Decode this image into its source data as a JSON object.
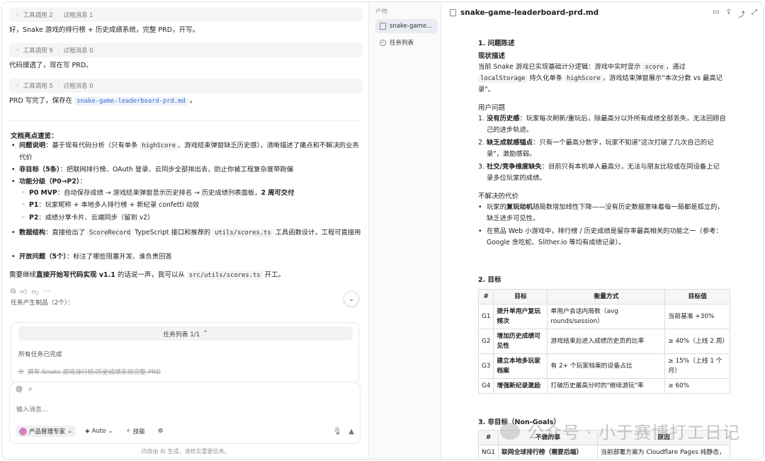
{
  "chat": {
    "tool_rows": [
      {
        "label": "工具调用 2",
        "sep": "·",
        "sub": "过程消息 1"
      },
      {
        "label": "工具调用 9",
        "sep": "·",
        "sub": "过程消息 0"
      },
      {
        "label": "工具调用 5",
        "sep": "·",
        "sub": "过程消息 0"
      }
    ],
    "msg1": "好，Snake 游戏的排行榜 + 历史成绩系统，完整 PRD，开写。",
    "msg2": "代码摸透了，现在写 PRD。",
    "msg3_pre": "PRD 写完了，保存在",
    "msg3_file": "snake-game-leaderboard-prd.md",
    "msg3_post": "。",
    "highlights_title": "文档亮点速览：",
    "bullets": {
      "b1_bold": "问题说明",
      "b1_a": "：基于现有代码分析（只有单条 ",
      "b1_code": "highScore",
      "b1_b": "、游戏结束弹窗缺乏历史感），清晰描述了痛点和不解决的业务代价",
      "b2_bold": "非目标（5条）",
      "b2_text": "：把联网排行榜、OAuth 登录、云同步全部排出去，防止你被工程复杂度带跑偏",
      "b3_bold": "功能分级（P0→P2）",
      "b3_text": "：",
      "s1_bold": "P0 MVP",
      "s1_text": "：自动保存成绩 → 游戏结束弹窗显示历史排名 → 历史成绩列表面板，",
      "s1_bold2": "2 周可交付",
      "s2_bold": "P1",
      "s2_text": "：玩家昵称 + 本地多人排行榜 + 新纪录 confetti 动效",
      "s3_bold": "P2",
      "s3_text": "：成绩分享卡片、云端同步（留到 v2）",
      "b4_bold": "数据结构",
      "b4_a": "：直接给出了 ",
      "b4_code1": "ScoreRecord",
      "b4_b": " TypeScript 接口和推荐的 ",
      "b4_code2": "utils/scores.ts",
      "b4_c": " 工具函数设计，工程可直接用",
      "b5_bold": "开放问题（5个）",
      "b5_text": "：标注了哪些阻塞开发、谁负责回答"
    },
    "closing_pre": "需要继续",
    "closing_bold": "直接开始写代码实现 v1.1",
    "closing_mid": " 的话说一声，我可以从 ",
    "closing_code": "src/utils/scores.ts",
    "closing_post": " 开工。",
    "artifacts_label": "任务产生制品（2个）：",
    "task_list": {
      "header": "任务列表 1/1",
      "status": "所有任务已完成",
      "item": "撰写 Snake 游戏排行榜/历史成绩系统完整 PRD"
    },
    "composer": {
      "placeholder": "输入消息...",
      "agent": "产品管理专家",
      "mode": "Auto",
      "skills": "技能"
    },
    "footnote": "内容由 AI 生成，请核实重要信息。"
  },
  "artifacts": {
    "label": "产物",
    "items": [
      "snake-game...",
      "任务列表"
    ]
  },
  "doc": {
    "title": "snake-game-leaderboard-prd.md",
    "s1_title": "1. 问题陈述",
    "s1_sub": "现状描述",
    "s1_p_a": "当前 Snake 游戏已实现基础计分逻辑：游戏中实时显示 ",
    "s1_p_code1": "score",
    "s1_p_b": "，通过 ",
    "s1_p_code2": "localStorage",
    "s1_p_c": " 持久化单条 ",
    "s1_p_code3": "highScore",
    "s1_p_d": "，游戏结束弹窗展示\"本次分数 vs 最高记录\"。",
    "user_problems": "用户问题",
    "problems": [
      {
        "n": "1.",
        "bold": "没有历史感",
        "text": "：玩家每次刷新/重玩后，除最高分以外所有成绩全部丢失，无法回顾自己的进步轨迹。"
      },
      {
        "n": "2.",
        "bold": "缺乏成就感锚点",
        "text": "：只有一个最高分数字，玩家不知道\"这次打破了几次自己的记录\"，激励感弱。"
      },
      {
        "n": "3.",
        "bold": "社交/竞争维度缺失",
        "text": "：目前只有本机单人最高分，无法与朋友比较或在同设备上记录多位玩家的成绩。"
      }
    ],
    "cost_title": "不解决的代价",
    "costs": [
      {
        "pre": "玩家的",
        "bold": "复玩动机",
        "text": "随局数增加线性下降——没有历史数据意味着每一局都是孤立的，缺乏进步可见性。"
      },
      {
        "pre": "",
        "bold": "",
        "text": "在竞品 Web 小游戏中，排行榜 / 历史成绩是留存率最高相关的功能之一（参考：Google 贪吃蛇、Slither.io 等均有成绩记录）。"
      }
    ],
    "s2_title": "2. 目标",
    "goals_headers": [
      "#",
      "目标",
      "衡量方式",
      "目标值"
    ],
    "goals": [
      {
        "id": "G1",
        "goal": "提升单用户复玩频次",
        "measure": "单用户会话内局数（avg rounds/session）",
        "target": "当前基准 +30%"
      },
      {
        "id": "G2",
        "goal": "增加历史成绩可见性",
        "measure": "游戏结束后进入成绩历史页的比率",
        "target": "≥ 40%（上线 2 周）"
      },
      {
        "id": "G3",
        "goal": "建立本地多玩家档案",
        "measure": "有 2+ 个玩家档案的设备占比",
        "target": "≥ 15%（上线 1 个月）"
      },
      {
        "id": "G4",
        "goal": "增强新纪录激励",
        "measure": "打破历史最高分时的\"继续游玩\"率",
        "target": "≥ 60%"
      }
    ],
    "s3_title": "3. 非目标（Non-Goals）",
    "ng_headers": [
      "#",
      "不做的事",
      "原因"
    ],
    "ng_row": {
      "id": "NG1",
      "item": "联网全球排行榜（需要后端）",
      "reason": "当前部署方案为 Cloudflare Pages 纯静态，"
    },
    "watermark": "公众号 · 小于赛博打工日记"
  }
}
